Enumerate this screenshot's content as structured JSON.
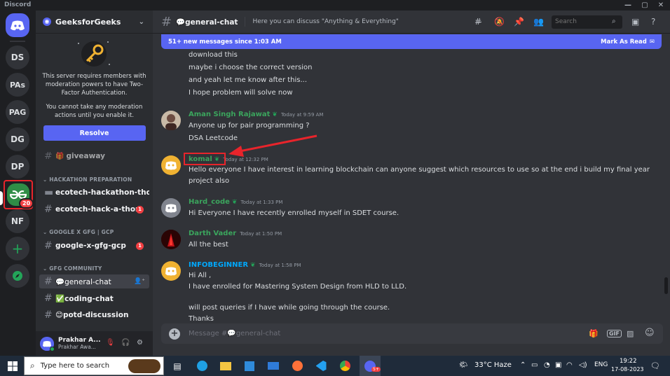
{
  "window": {
    "title": "Discord",
    "controls": [
      "—",
      "▢",
      "✕"
    ]
  },
  "servers": {
    "items": [
      {
        "label": "DS"
      },
      {
        "label": "PAs"
      },
      {
        "label": "PAG"
      },
      {
        "label": "DG"
      },
      {
        "label": "DP"
      },
      {
        "label": "NF"
      }
    ],
    "active": {
      "label": "GfG",
      "badge": "20"
    },
    "add_label": "+",
    "explore_label": "⊘"
  },
  "sidebar": {
    "server_name": "GeeksforGeeks",
    "mfa_notice": {
      "line1": "This server requires members with moderation powers to have Two-Factor Authentication.",
      "line2": "You cannot take any moderation actions until you enable it.",
      "button": "Resolve"
    },
    "partial_channel": "giveaway",
    "categories": [
      {
        "name": "HACKATHON PREPARATION",
        "channels": [
          {
            "name": "ecotech-hackathon-tho...",
            "type": "forum"
          },
          {
            "name": "ecotech-hack-a-thon",
            "badge": "1"
          }
        ]
      },
      {
        "name": "GOOGLE X GFG | GCP",
        "channels": [
          {
            "name": "google-x-gfg-gcp",
            "badge": "1"
          }
        ]
      },
      {
        "name": "GFG COMMUNITY",
        "channels": [
          {
            "name": "💬general-chat",
            "selected": true
          },
          {
            "name": "✅coding-chat"
          },
          {
            "name": "😊potd-discussion"
          }
        ]
      }
    ]
  },
  "user_panel": {
    "name": "Prakhar A...",
    "status": "Prakhar Awa..."
  },
  "header": {
    "channel": "💬general-chat",
    "topic": "Here you can discuss \"Anything & Everything\"",
    "search_placeholder": "Search"
  },
  "new_messages": {
    "text": "51+ new messages since 1:03 AM",
    "action": "Mark As Read"
  },
  "messages": {
    "continued": [
      "download this",
      "maybe i choose the correct version",
      "and yeah let me know after this...",
      "I hope problem will solve now"
    ],
    "posts": [
      {
        "author": "Aman Singh Rajawat",
        "time": "Today at 9:59 AM",
        "color": "#3ba55d",
        "lines": [
          "Anyone up for pair programming ?",
          "DSA Leetcode"
        ]
      },
      {
        "author": "komal",
        "time": "Today at 12:32 PM",
        "color": "#3ba55d",
        "lines": [
          "Hello everyone I have interest in learning blockchain can anyone suggest which resources to use so at the end i build my final year",
          "project also"
        ]
      },
      {
        "author": "Hard_code",
        "time": "Today at 1:33 PM",
        "color": "#3ba55d",
        "lines": [
          "Hi Everyone I have recently enrolled myself in SDET course."
        ]
      },
      {
        "author": "Darth Vader",
        "time": "Today at 1:50 PM",
        "color": "#3ba55d",
        "lines": [
          "All the best"
        ]
      },
      {
        "author": "INFOBEGINNER",
        "time": "Today at 1:58 PM",
        "color": "#00a8fc",
        "lines": [
          "Hi All ,",
          "I have enrolled for Mastering System Design from HLD to LLD.",
          "",
          "will post queries if I have while going through the course.",
          "Thanks"
        ]
      }
    ]
  },
  "composer": {
    "placeholder": "Message #💬general-chat"
  },
  "taskbar": {
    "search_placeholder": "Type here to search",
    "weather": "33°C  Haze",
    "lang": "ENG",
    "time": "19:22",
    "date": "17-08-2023",
    "notif": "3"
  },
  "colors": {
    "accent": "#5865f2",
    "annotation": "#e8242b",
    "gfg_green": "#2f8d46"
  }
}
